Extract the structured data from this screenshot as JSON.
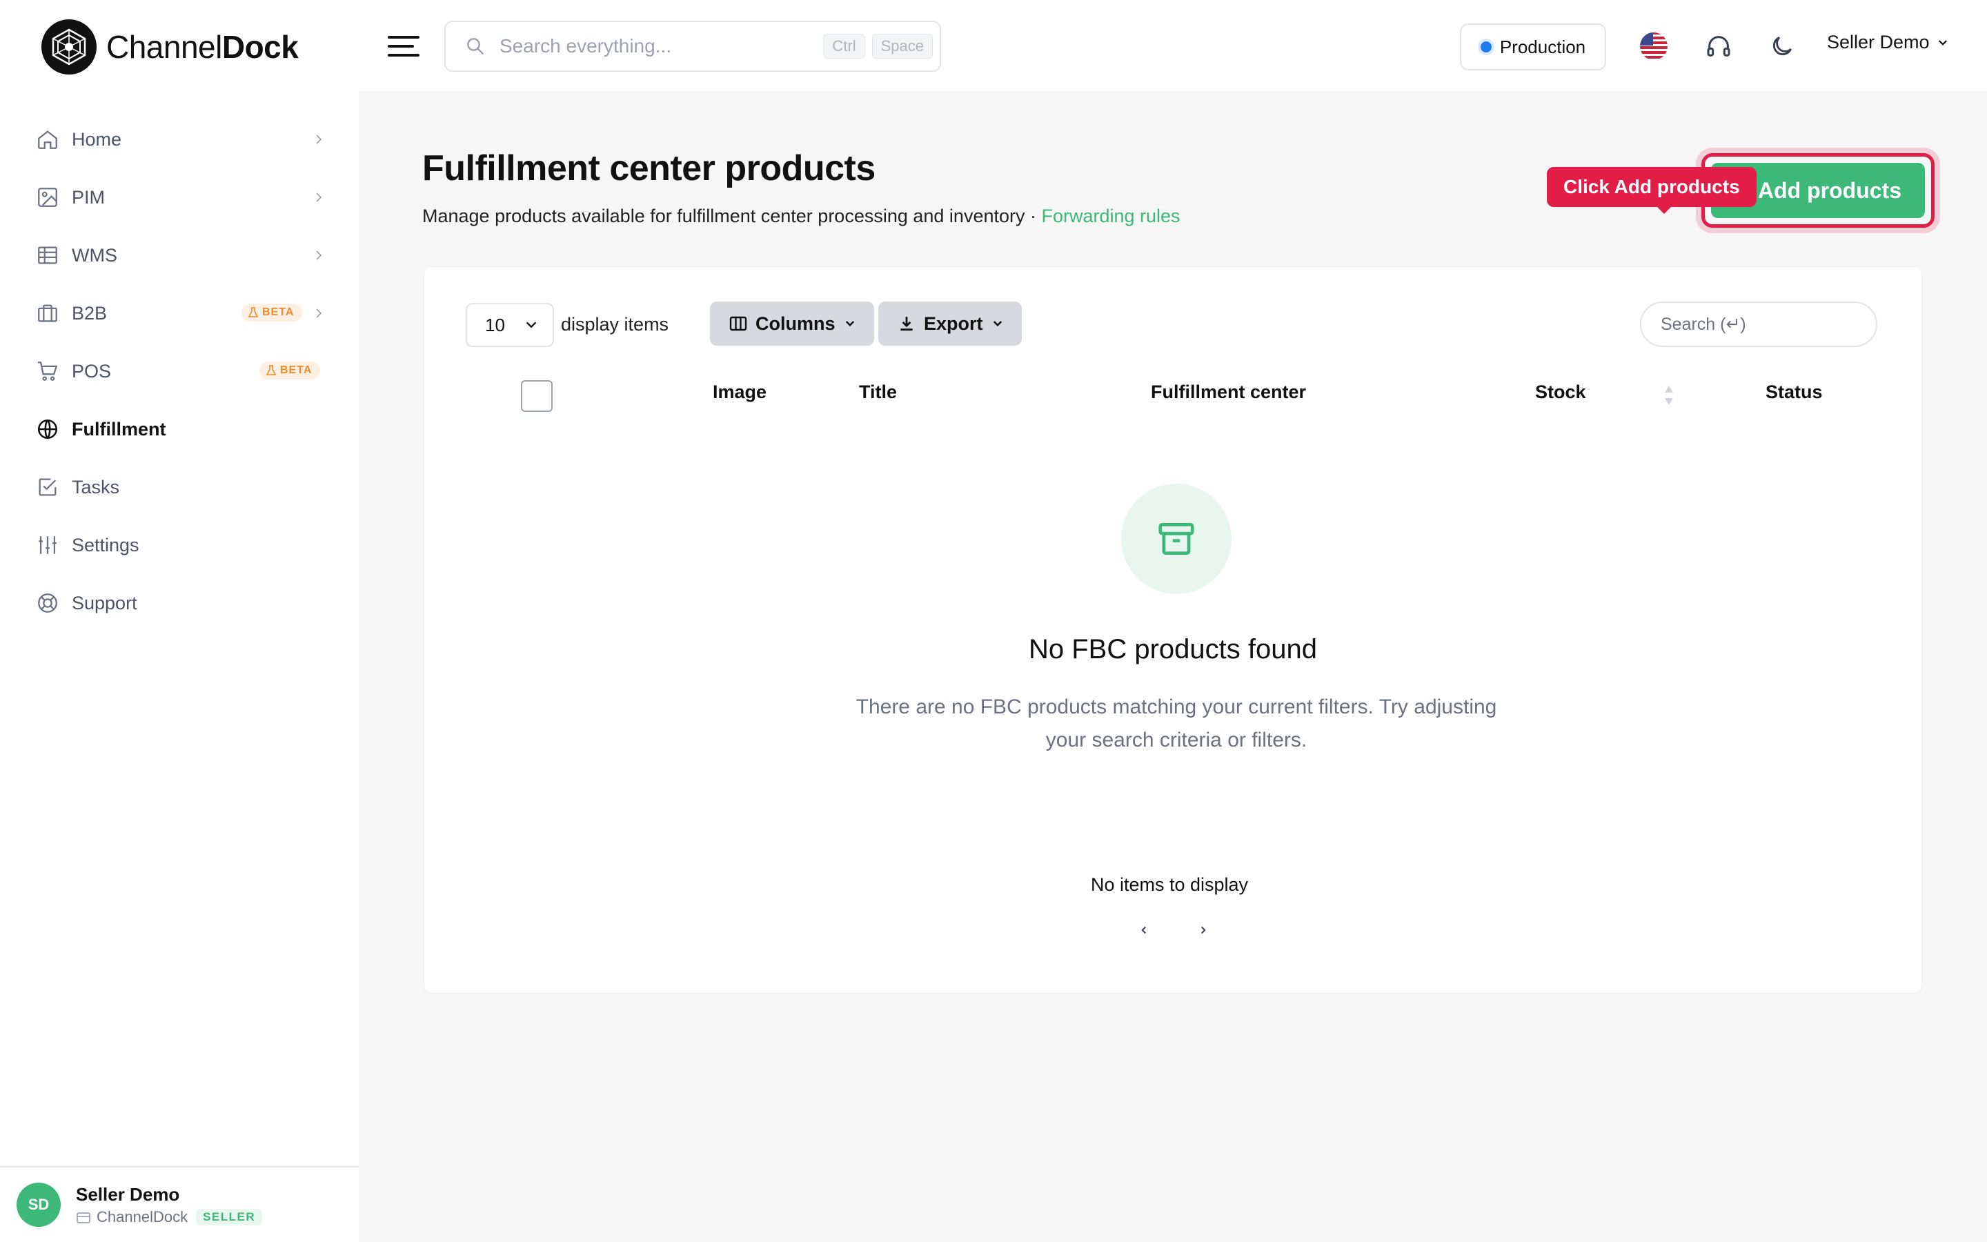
{
  "brand": {
    "name_regular": "Channel",
    "name_bold": "Dock"
  },
  "sidebar": {
    "items": [
      {
        "label": "Home",
        "icon": "home-icon",
        "chevron": true
      },
      {
        "label": "PIM",
        "icon": "image-icon",
        "chevron": true
      },
      {
        "label": "WMS",
        "icon": "table-icon",
        "chevron": true
      },
      {
        "label": "B2B",
        "icon": "briefcase-icon",
        "chevron": true,
        "badge": "BETA"
      },
      {
        "label": "POS",
        "icon": "cart-icon",
        "chevron": false,
        "badge": "BETA"
      },
      {
        "label": "Fulfillment",
        "icon": "globe-icon",
        "chevron": false,
        "active": true
      },
      {
        "label": "Tasks",
        "icon": "check-square-icon",
        "chevron": false
      },
      {
        "label": "Settings",
        "icon": "sliders-icon",
        "chevron": false
      },
      {
        "label": "Support",
        "icon": "lifebuoy-icon",
        "chevron": false
      }
    ],
    "footer": {
      "initials": "SD",
      "name": "Seller Demo",
      "org": "ChannelDock",
      "role": "SELLER"
    }
  },
  "header": {
    "search_placeholder": "Search everything...",
    "shortcut_1": "Ctrl",
    "shortcut_2": "Space",
    "environment": "Production",
    "user_menu": "Seller Demo"
  },
  "page": {
    "title": "Fulfillment center products",
    "subtitle": "Manage products available for fulfillment center processing and inventory · ",
    "subtitle_link": "Forwarding rules",
    "add_button": "Add products",
    "tooltip": "Click Add products"
  },
  "table": {
    "page_size": "10",
    "display_label": "display items",
    "columns_button": "Columns",
    "export_button": "Export",
    "search_placeholder": "Search (↵)",
    "headers": {
      "image": "Image",
      "title": "Title",
      "center": "Fulfillment center",
      "stock": "Stock",
      "status": "Status"
    },
    "empty_title": "No FBC products found",
    "empty_desc": "There are no FBC products matching your current filters. Try adjusting your search criteria or filters.",
    "no_items": "No items to display"
  },
  "colors": {
    "accent": "#3cb879",
    "highlight": "#e11d48",
    "env_dot": "#1e7bf2"
  }
}
